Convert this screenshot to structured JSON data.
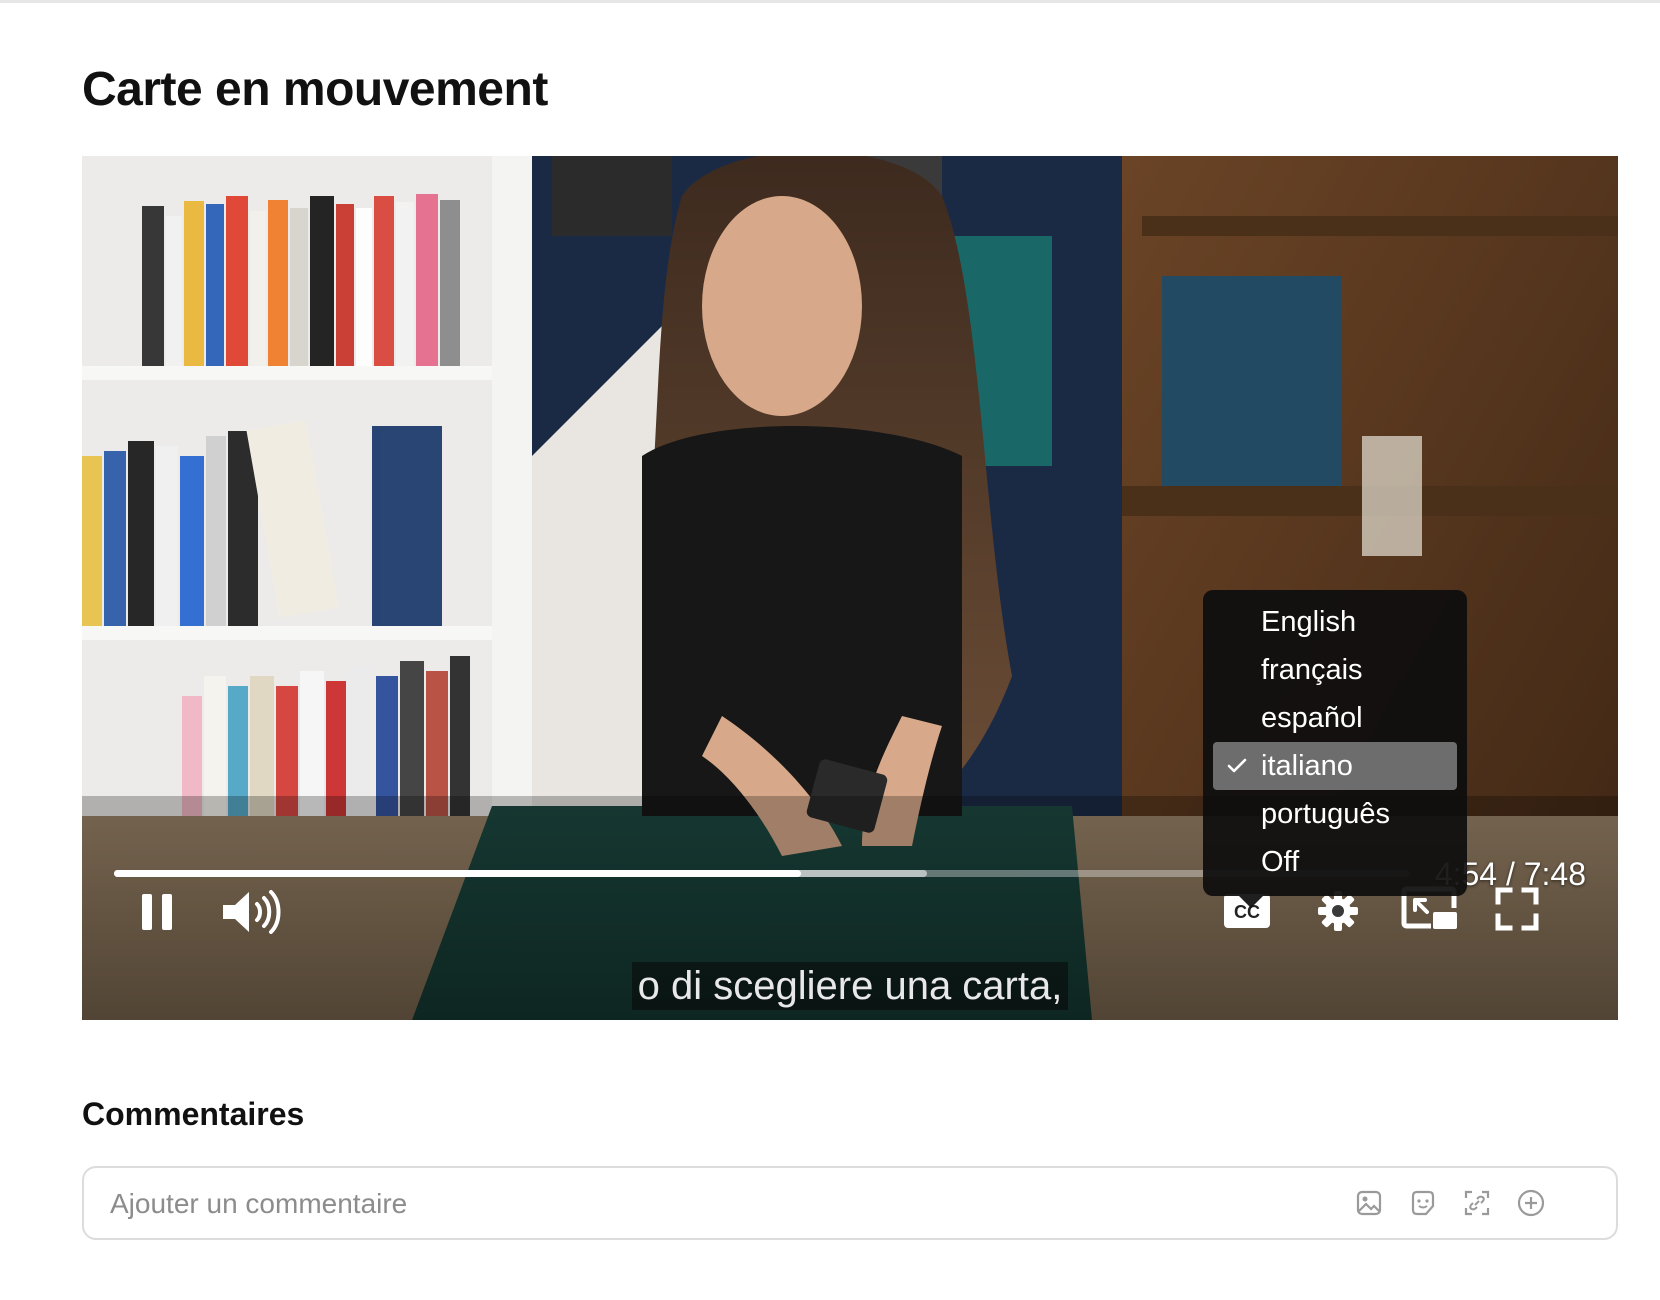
{
  "page": {
    "title": "Carte en mouvement"
  },
  "video": {
    "subtitle_text": "o di scegliere una carta,",
    "time_display": "4:54 / 7:48",
    "progress": {
      "played_fraction": 0.53,
      "buffered_fraction": 0.627
    },
    "controls": {
      "play_state_icon": "pause-icon",
      "volume_icon": "volume-icon",
      "cc_label": "CC",
      "settings_icon": "gear-icon",
      "pip_icon": "picture-in-picture-icon",
      "fullscreen_icon": "fullscreen-icon"
    },
    "captions_menu": {
      "items": [
        {
          "label": "English",
          "selected": false
        },
        {
          "label": "français",
          "selected": false
        },
        {
          "label": "español",
          "selected": false
        },
        {
          "label": "italiano",
          "selected": true
        },
        {
          "label": "português",
          "selected": false
        },
        {
          "label": "Off",
          "selected": false
        }
      ]
    }
  },
  "comments": {
    "heading": "Commentaires",
    "input": {
      "placeholder": "Ajouter un commentaire",
      "value": "",
      "actions": [
        "image-icon",
        "sticker-icon",
        "link-icon",
        "plus-circle-icon"
      ]
    }
  },
  "colors": {
    "selected_item_bg": "#6d6d6d",
    "menu_bg": "#0e0e0e",
    "progress_played": "#ffffff"
  }
}
